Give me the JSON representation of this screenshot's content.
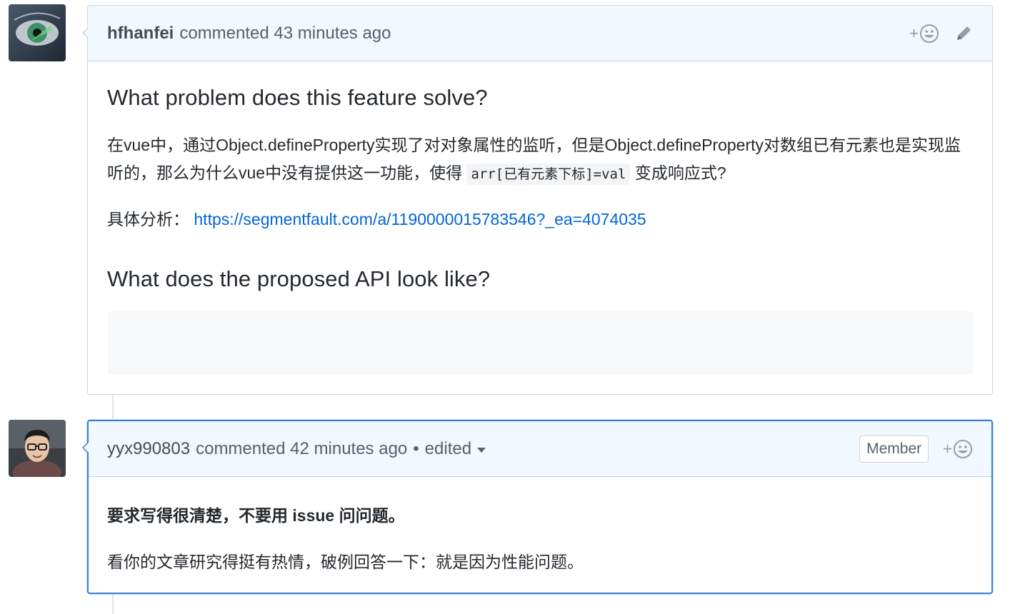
{
  "comments": [
    {
      "author": "hfhanfei",
      "action": "commented",
      "time": "43 minutes ago",
      "heading1": "What problem does this feature solve?",
      "paragraph1_before_code": "在vue中，通过Object.defineProperty实现了对对象属性的监听，但是Object.defineProperty对数组已有元素也是实现监听的，那么为什么vue中没有提供这一功能，使得",
      "paragraph1_code": "arr[已有元素下标]=val",
      "paragraph1_after_code": "变成响应式?",
      "analysis_label": "具体分析：",
      "analysis_link": "https://segmentfault.com/a/1190000015783546?_ea=4074035",
      "heading2": "What does the proposed API look like?",
      "reaction_plus": "+",
      "icons": [
        "smiley-icon",
        "pencil-icon"
      ]
    },
    {
      "author": "yyx990803",
      "action": "commented",
      "time": "42 minutes ago",
      "separator": "•",
      "edited": "edited",
      "badge": "Member",
      "reaction_plus": "+",
      "bold_line": "要求写得很清楚，不要用 issue 问问题。",
      "line2": "看你的文章研究得挺有热情，破例回答一下：就是因为性能问题。",
      "icons": [
        "smiley-icon",
        "chevron-down-icon"
      ]
    }
  ],
  "colors": {
    "header_bg": "#f1f8ff",
    "link": "#0366d6",
    "active_border": "#3b7fcf",
    "border": "#d1d5da"
  }
}
